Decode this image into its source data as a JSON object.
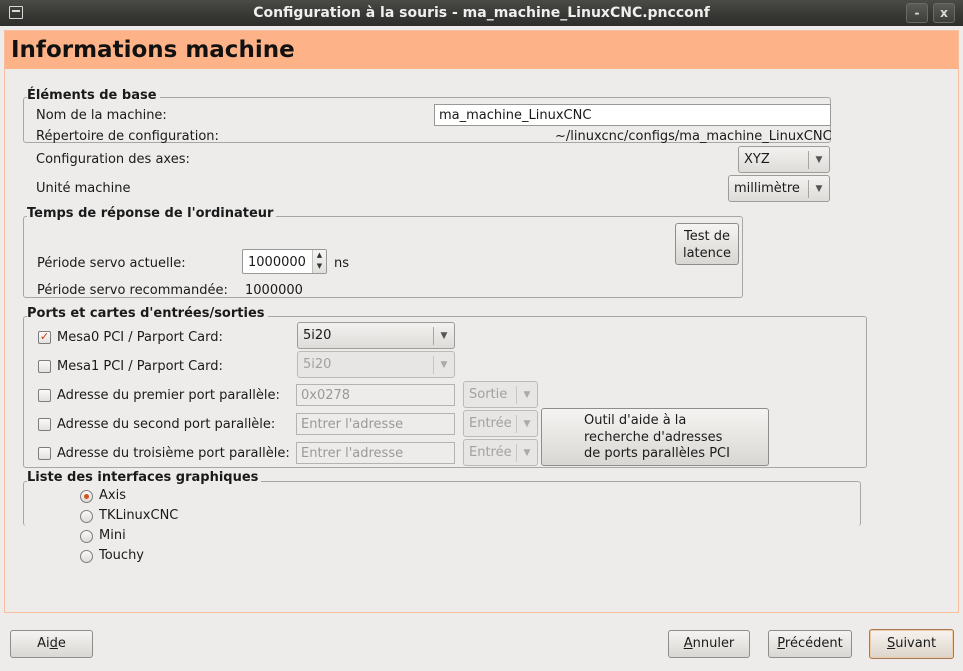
{
  "window": {
    "title": "Configuration à la souris - ma_machine_LinuxCNC.pncconf",
    "controls": [
      "-",
      "x"
    ]
  },
  "header": {
    "title": "Informations machine"
  },
  "base": {
    "title": "Éléments de base",
    "machine_name_label": "Nom de la machine:",
    "machine_name_value": "ma_machine_LinuxCNC",
    "config_dir_label": "Répertoire de configuration:",
    "config_dir_value": "~/linuxcnc/configs/ma_machine_LinuxCNC",
    "axes_label": "Configuration des axes:",
    "axes_value": "XYZ",
    "unit_label": "Unité machine",
    "unit_value": "millimètre"
  },
  "timing": {
    "title": "Temps de réponse de l'ordinateur",
    "latency_button_line1": "Test de",
    "latency_button_line2": "latence",
    "servo_label": "Période servo actuelle:",
    "servo_value": "1000000",
    "servo_unit": "ns",
    "recommended_label": "Période servo recommandée:",
    "recommended_value": "1000000"
  },
  "ports": {
    "title": "Ports et cartes d'entrées/sorties",
    "mesa0_label": "Mesa0 PCI / Parport Card:",
    "mesa0_checked": true,
    "mesa0_value": "5i20",
    "mesa1_label": "Mesa1 PCI / Parport Card:",
    "mesa1_checked": false,
    "mesa1_value": "5i20",
    "pp1_label": "Adresse du premier port parallèle:",
    "pp1_value": "0x0278",
    "pp1_dir": "Sortie",
    "pp2_label": "Adresse du second port parallèle:",
    "pp2_placeholder": "Entrer l'adresse",
    "pp2_dir": "Entrée",
    "pp3_label": "Adresse du troisième port parallèle:",
    "pp3_placeholder": "Entrer l'adresse",
    "pp3_dir": "Entrée",
    "pci_helper_line1": "Outil d'aide à la",
    "pci_helper_line2": "recherche d'adresses",
    "pci_helper_line3": "de ports parallèles PCI"
  },
  "gui": {
    "title": "Liste des interfaces graphiques",
    "options": [
      "Axis",
      "TKLinuxCNC",
      "Mini",
      "Touchy"
    ],
    "selected": "Axis"
  },
  "footer": {
    "help_pre": "Ai",
    "help_key": "d",
    "help_post": "e",
    "cancel_key": "A",
    "cancel_post": "nnuler",
    "prev_key": "P",
    "prev_post": "récédent",
    "next_key": "S",
    "next_post": "uivant"
  },
  "colors": {
    "header_bg": "#fdb387",
    "accent": "#d45419",
    "titlebar_bg": "#3c3b37"
  }
}
